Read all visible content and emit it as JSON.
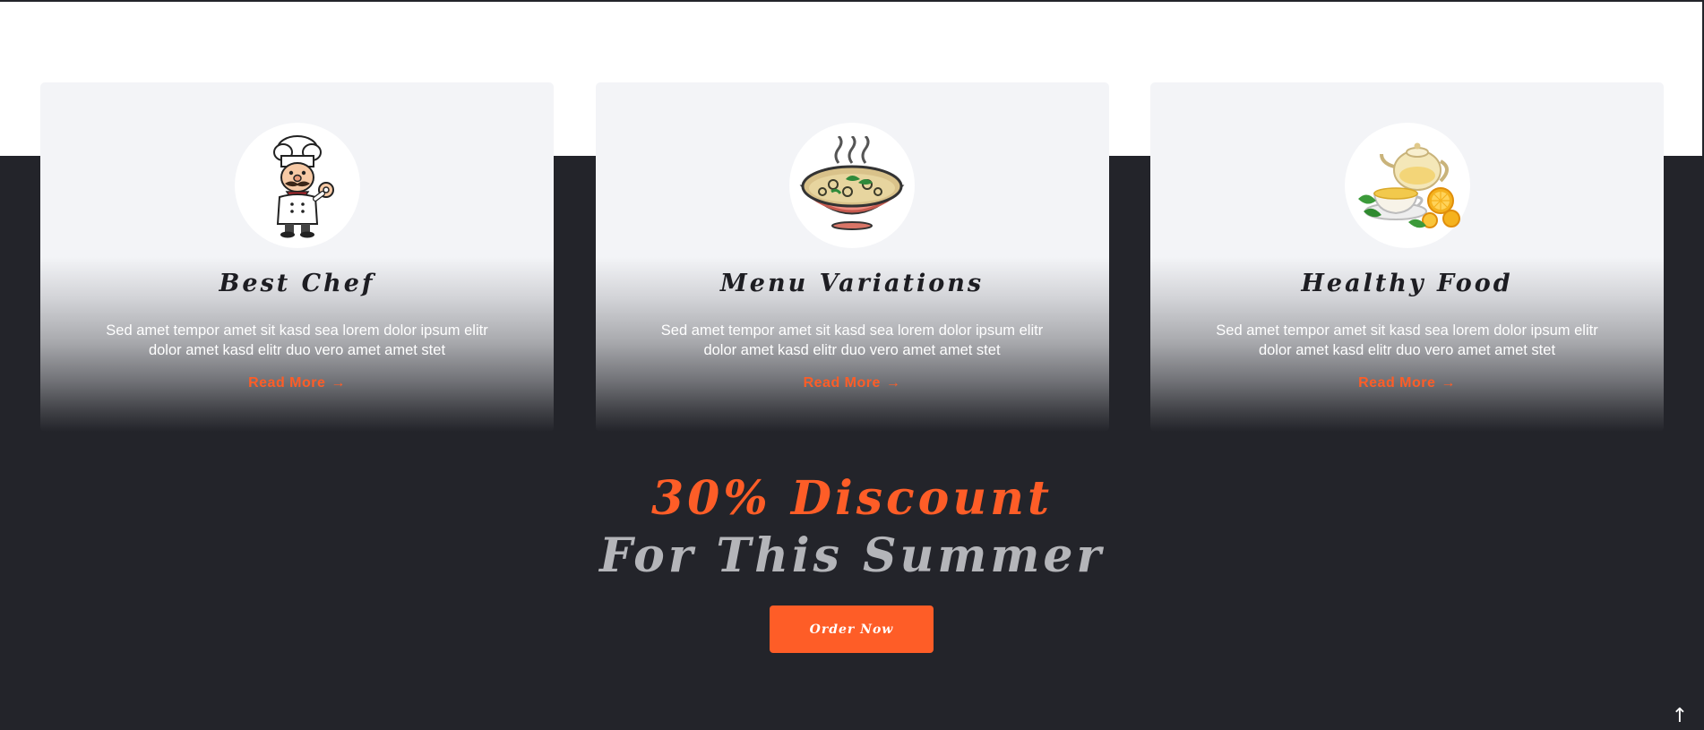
{
  "features": [
    {
      "title": "Best Chef",
      "icon": "chef-icon",
      "text": "Sed amet tempor amet sit kasd sea lorem dolor ipsum elitr dolor amet kasd elitr duo vero amet amet stet",
      "link_label": "Read More",
      "link_arrow": "→"
    },
    {
      "title": "Menu Variations",
      "icon": "soup-bowl-icon",
      "text": "Sed amet tempor amet sit kasd sea lorem dolor ipsum elitr dolor amet kasd elitr duo vero amet amet stet",
      "link_label": "Read More",
      "link_arrow": "→"
    },
    {
      "title": "Healthy Food",
      "icon": "tea-lemon-icon",
      "text": "Sed amet tempor amet sit kasd sea lorem dolor ipsum elitr dolor amet kasd elitr duo vero amet amet stet",
      "link_label": "Read More",
      "link_arrow": "→"
    }
  ],
  "promo": {
    "line1": "30% Discount",
    "line2": "For This Summer",
    "button_label": "Order Now"
  },
  "back_to_top": {
    "icon": "arrow-up-icon",
    "glyph": "↑"
  },
  "colors": {
    "accent": "#fe5d27",
    "dark": "#23242a",
    "card_bg": "#f3f4f7",
    "muted_text": "#b4b5b9"
  }
}
